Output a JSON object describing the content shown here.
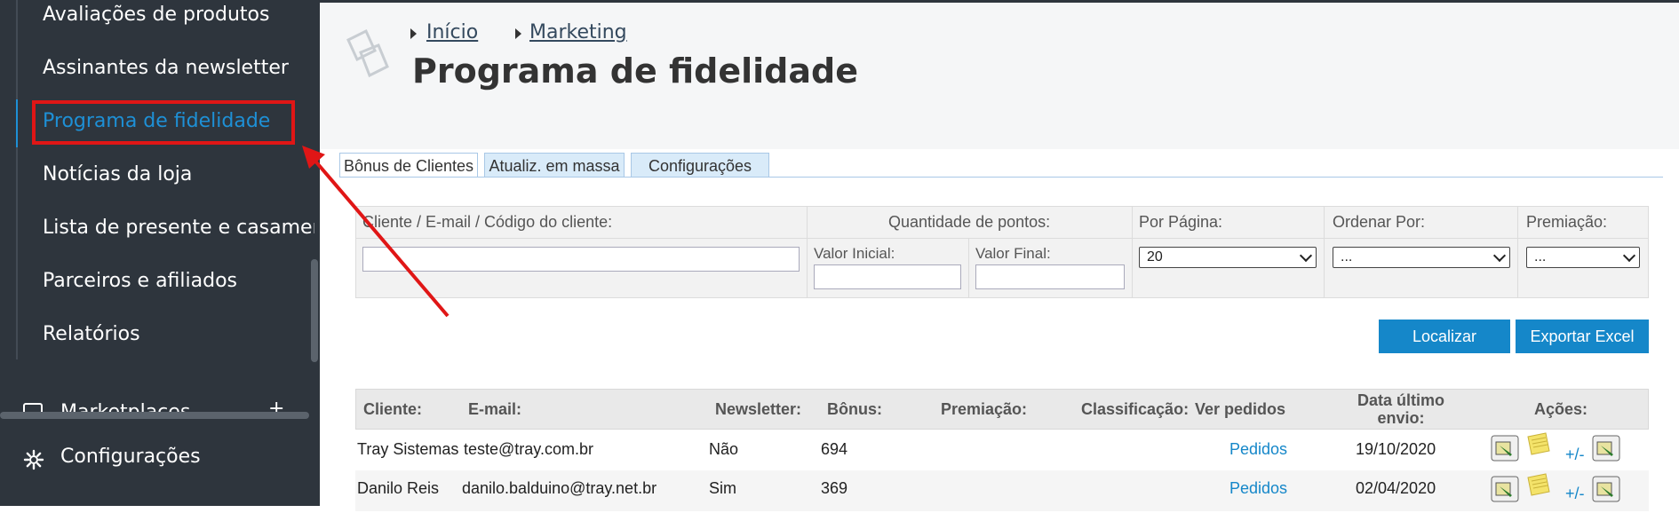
{
  "sidebar": {
    "items": [
      {
        "label": "Avaliações de produtos"
      },
      {
        "label": "Assinantes da newsletter"
      },
      {
        "label": "Programa de fidelidade"
      },
      {
        "label": "Notícias da loja"
      },
      {
        "label": "Lista de presente e casamento"
      },
      {
        "label": "Parceiros e afiliados"
      },
      {
        "label": "Relatórios"
      }
    ],
    "partial_item": "Marketplaces",
    "partial_plus": "+",
    "footer": {
      "label": "Configurações",
      "icon": "gear-icon"
    }
  },
  "breadcrumb": [
    "Início",
    "Marketing"
  ],
  "page_title": "Programa de fidelidade",
  "tabs": [
    "Bônus de Clientes",
    "Atualiz. em massa",
    "Configurações"
  ],
  "filters": {
    "customer_label": "Cliente / E-mail / Código do cliente:",
    "points_label": "Quantidade de pontos:",
    "initial_label": "Valor Inicial:",
    "final_label": "Valor Final:",
    "per_page_label": "Por Página:",
    "per_page_value": "20",
    "order_label": "Ordenar Por:",
    "order_value": "...",
    "prize_label": "Premiação:",
    "prize_value": "..."
  },
  "buttons": {
    "search": "Localizar",
    "export": "Exportar Excel"
  },
  "table": {
    "headers": [
      "Cliente:",
      "E-mail:",
      "Newsletter:",
      "Bônus:",
      "Premiação:",
      "Classificação:",
      "Ver pedidos",
      "Data último envio:",
      "Ações:"
    ],
    "rows": [
      {
        "client": "Tray Sistemas",
        "email": "teste@tray.com.br",
        "newsletter": "Não",
        "bonus": "694",
        "orders": "Pedidos",
        "date": "19/10/2020",
        "plusminus": "+/-"
      },
      {
        "client": "Danilo Reis",
        "email": "danilo.balduino@tray.net.br",
        "newsletter": "Sim",
        "bonus": "369",
        "orders": "Pedidos",
        "date": "02/04/2020",
        "plusminus": "+/-"
      }
    ]
  },
  "colors": {
    "sidebar_bg": "#2e353d",
    "accent": "#1e90d6",
    "button": "#1587c9",
    "highlight": "#e01616"
  }
}
